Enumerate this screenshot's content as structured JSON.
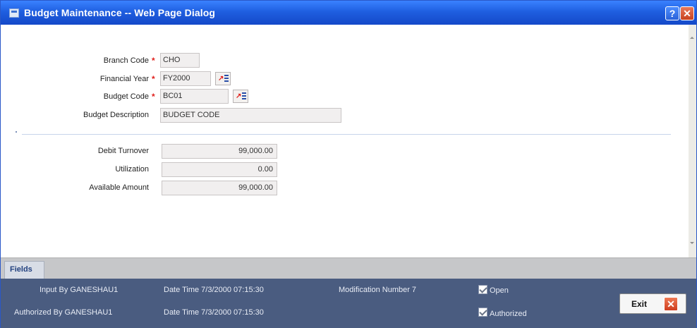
{
  "window": {
    "title": "Budget Maintenance -- Web Page Dialog",
    "help_glyph": "?",
    "close_glyph": "✕"
  },
  "form": {
    "branch_code": {
      "label": "Branch Code",
      "value": "CHO",
      "required": true
    },
    "financial_year": {
      "label": "Financial Year",
      "value": "FY2000",
      "required": true,
      "icon": "lov-icon"
    },
    "budget_code": {
      "label": "Budget Code",
      "value": "BC01",
      "required": true,
      "icon": "lov-icon"
    },
    "budget_description": {
      "label": "Budget Description",
      "value": "BUDGET CODE"
    },
    "debit_turnover": {
      "label": "Debit Turnover",
      "value": "99,000.00"
    },
    "utilization": {
      "label": "Utilization",
      "value": "0.00"
    },
    "available_amount": {
      "label": "Available Amount",
      "value": "99,000.00"
    },
    "required_marker": "*"
  },
  "tabs": {
    "fields_label": "Fields"
  },
  "footer": {
    "input_by": "Input By GANESHAU1",
    "authorized_by": "Authorized By GANESHAU1",
    "input_datetime": "Date Time 7/3/2000 07:15:30",
    "auth_datetime": "Date Time 7/3/2000 07:15:30",
    "modification": "Modification Number 7",
    "open_label": "Open",
    "open_checked": true,
    "authorized_label": "Authorized",
    "authorized_checked": true,
    "exit_label": "Exit",
    "exit_glyph": "✕"
  },
  "colors": {
    "titlebar": "#1f5fe0",
    "footer": "#4a5c80",
    "required": "#e0201c",
    "tab_text": "#22417f"
  }
}
